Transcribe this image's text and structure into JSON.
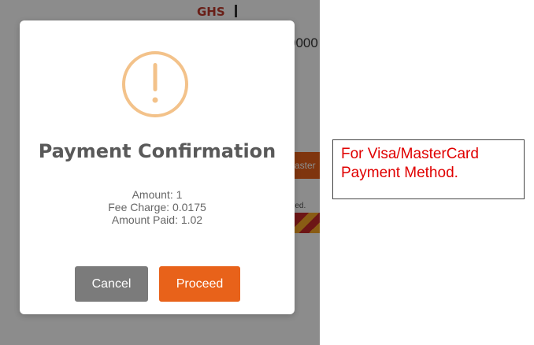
{
  "background": {
    "currency": "GHS",
    "amount_fragment": "0000",
    "button_fragment": "Master",
    "footer_fragment": "rved."
  },
  "dialog": {
    "icon": "exclamation-circle-icon",
    "title": "Payment Confirmation",
    "details": [
      "Amount: 1",
      "Fee Charge: 0.0175",
      "Amount Paid: 1.02"
    ],
    "cancel_label": "Cancel",
    "proceed_label": "Proceed"
  },
  "annotation": {
    "line1": "For Visa/MasterCard",
    "line2": "Payment Method."
  },
  "colors": {
    "accent": "#e8621a",
    "warning_icon": "#f3c28a",
    "cancel": "#7b7b7b",
    "annotation_text": "#e00000"
  }
}
